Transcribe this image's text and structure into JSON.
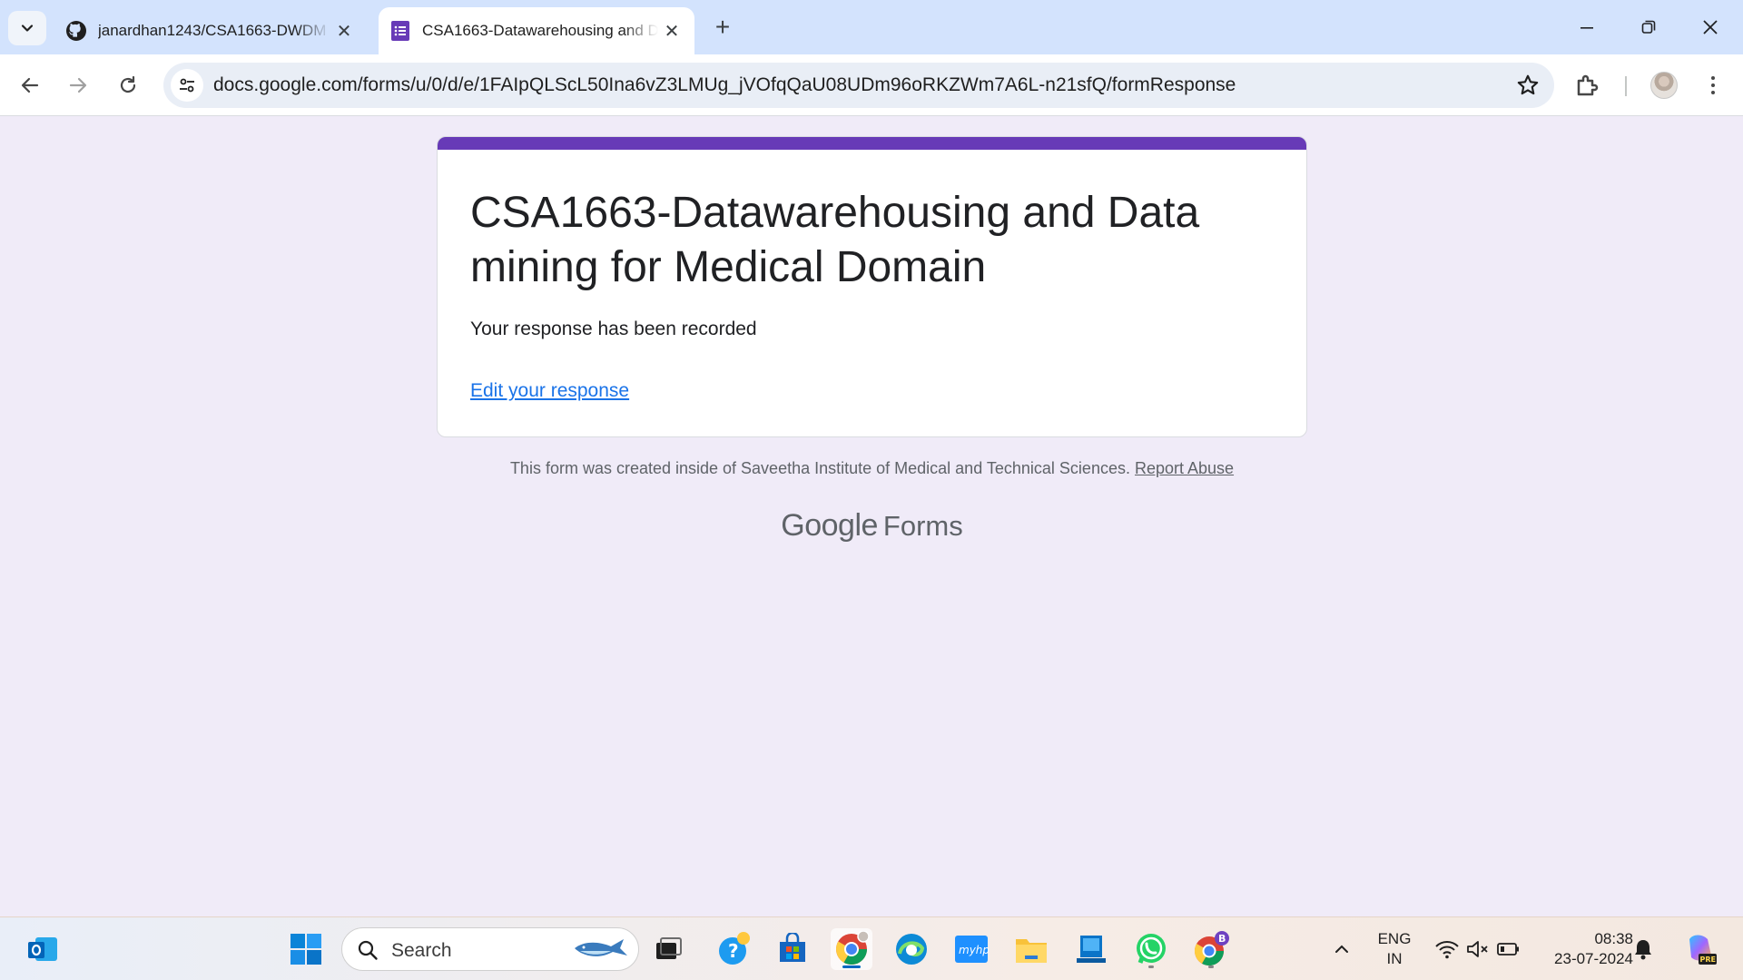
{
  "browser": {
    "tabs": [
      {
        "title": "janardhan1243/CSA1663-DWDM",
        "icon": "github-icon",
        "active": false
      },
      {
        "title": "CSA1663-Datawarehousing and Data mining for Medical Domain",
        "icon": "google-forms-icon",
        "active": true
      }
    ],
    "address_bar": {
      "url": "docs.google.com/forms/u/0/d/e/1FAIpQLScL50Ina6vZ3LMUg_jVOfqQaU08UDm96oRKZWm7A6L-n21sfQ/formResponse"
    }
  },
  "form": {
    "title": "CSA1663-Datawarehousing and Data mining for Medical Domain",
    "confirmation": "Your response has been recorded",
    "edit_link": "Edit your response",
    "footer_note": "This form was created inside of Saveetha Institute of Medical and Technical Sciences.",
    "report_abuse": "Report Abuse",
    "branding": {
      "google": "Google",
      "forms": "Forms"
    },
    "accent_color": "#673ab7",
    "page_background": "#f0ebf8"
  },
  "taskbar": {
    "search_label": "Search",
    "language": {
      "line1": "ENG",
      "line2": "IN"
    },
    "clock": {
      "time": "08:38",
      "date": "23-07-2024"
    },
    "chrome_profile_badge": "B",
    "copilot_badge": "PRE"
  }
}
